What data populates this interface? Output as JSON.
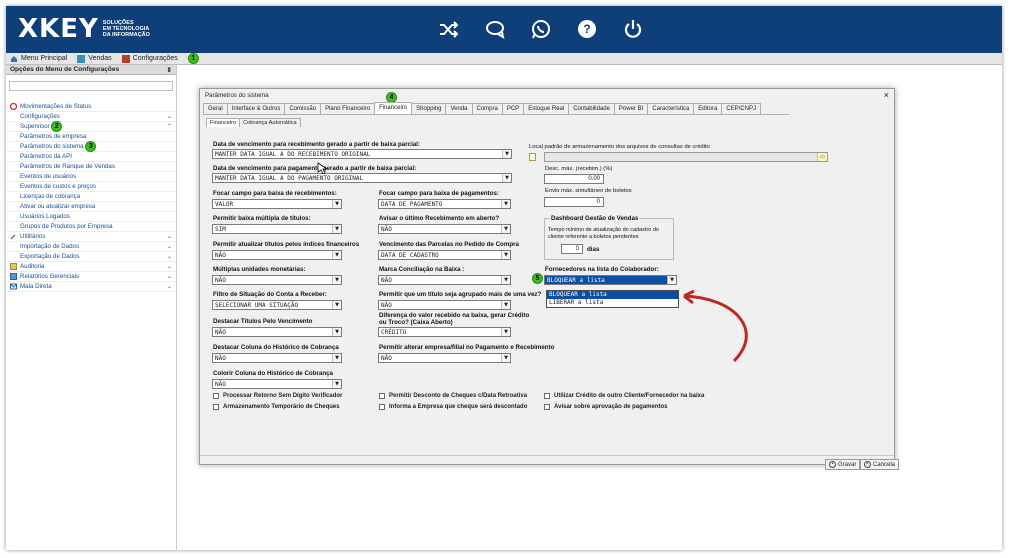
{
  "brand": {
    "name": "XKEY",
    "tagline_1": "SOLUÇÕES",
    "tagline_2": "EM TECNOLOGIA",
    "tagline_3": "DA INFORMAÇÃO"
  },
  "top_icons": [
    "shuffle-icon",
    "chat-icon",
    "whatsapp-icon",
    "help-icon",
    "power-icon"
  ],
  "menubar": {
    "items": [
      {
        "label": "Menu Principal",
        "icon": "home-icon"
      },
      {
        "label": "Vendas",
        "icon": "sales-icon"
      },
      {
        "label": "Configurações",
        "icon": "config-icon"
      }
    ],
    "badge": "1"
  },
  "sidebar": {
    "title": "Opções do Menu de Configurações",
    "items": [
      {
        "label": "Movimentações de Status",
        "type": "group"
      },
      {
        "label": "Configurações",
        "type": "group"
      },
      {
        "label": "Supervisor",
        "type": "group",
        "badge": "2"
      },
      {
        "label": "Parâmetros de empresa",
        "type": "sub"
      },
      {
        "label": "Parâmetros do sistema",
        "type": "sub",
        "badge": "3"
      },
      {
        "label": "Parâmetros da API",
        "type": "sub"
      },
      {
        "label": "Parâmetros de Ranque de Vendas",
        "type": "sub"
      },
      {
        "label": "Eventos de usuários",
        "type": "sub"
      },
      {
        "label": "Eventos de custos e preços",
        "type": "sub"
      },
      {
        "label": "Licenças de cobrança",
        "type": "sub"
      },
      {
        "label": "Ativar ou atualizar empresa",
        "type": "sub"
      },
      {
        "label": "Usuários Logados",
        "type": "sub"
      },
      {
        "label": "Grupos de Produtos por Empresa",
        "type": "sub"
      },
      {
        "label": "Utilitários",
        "type": "group"
      },
      {
        "label": "Importação de Dados",
        "type": "group"
      },
      {
        "label": "Exportação de Dados",
        "type": "group"
      },
      {
        "label": "Auditoria",
        "type": "group"
      },
      {
        "label": "Relatórios Gerenciais",
        "type": "group"
      },
      {
        "label": "Mala Direta",
        "type": "group"
      }
    ]
  },
  "dialog": {
    "title": "Parâmetros do sistema",
    "close": "×",
    "tabs": [
      "Geral",
      "Interface & Outros",
      "Comissão",
      "Plano Financeiro",
      "Financeiro",
      "Shopping",
      "Venda",
      "Compra",
      "PCP",
      "Estoque Real",
      "Contabilidade",
      "Power BI",
      "Característica",
      "Editora",
      "CEP/CNPJ"
    ],
    "tab_badge": "4",
    "subtabs": [
      "Financeiro",
      "Cobrança Automática"
    ],
    "fields": {
      "venc_receb_label": "Data de vencimento para recebimento gerado a partir de baixa parcial:",
      "venc_receb_value": "MANTER DATA IGUAL A DO RECEBIMENTO ORIGINAL",
      "venc_pag_label": "Data de vencimento para pagamento gerado a partir de baixa parcial:",
      "venc_pag_value": "MANTER DATA IGUAL A DO PAGAMENTO ORIGINAL",
      "focar_receb_label": "Focar campo para baixa de recebimentos:",
      "focar_receb_value": "VALOR",
      "focar_pag_label": "Focar campo para baixa de pagamentos:",
      "focar_pag_value": "DATA DE PAGAMENTO",
      "baixa_mult_label": "Permitir baixa múltipla de títulos:",
      "baixa_mult_value": "SIM",
      "avisar_label": "Avisar o último Recebimento em aberto?",
      "avisar_value": "NÃO",
      "atualizar_label": "Permitir atualizar títulos pelos índices financeiros",
      "atualizar_value": "NÃO",
      "venc_parc_label": "Vencimento das Parcelas no Pedido de Compra",
      "venc_parc_value": "DATA DE CADASTRO",
      "mult_unid_label": "Múltiplas unidades monetárias:",
      "mult_unid_value": "NÃO",
      "marca_conc_label": "Marca Conciliação na Baixa :",
      "marca_conc_value": "NÃO",
      "filtro_label": "Filtro de Situação do Conta a Receber:",
      "filtro_value": "SELECIONAR UMA SITUAÇÃO",
      "agrupado_label": "Permitir que um título seja agrupado mais de uma vez?",
      "agrupado_value": "NÃO",
      "destacar_venc_label": "Destacar Títulos Pelo Vencimento",
      "destacar_venc_value": "NÃO",
      "diferenca_label_1": "Diferença do valor recebido na baixa, gerar Crédito",
      "diferenca_label_2": "ou Troco? (Caixa Aberto)",
      "diferenca_value": "CRÉDITO",
      "destacar_col_label": "Destacar Coluna do Histórico de Cobrança",
      "destacar_col_value": "NÃO",
      "alterar_emp_label": "Permitir alterar empresa/filial no Pagamento e Recebimento",
      "alterar_emp_value": "NÃO",
      "colorir_label": "Colorir Coluna do Histórico de Cobrança",
      "colorir_value": "NÃO",
      "local_label": "Local padrão de armazenamento dos arquivos de consultas de crédito",
      "desc_label": "Desc. máx. (recebim.) (%)",
      "desc_value": "0.00",
      "envio_label": "Envio máx. simultâneo de boletos",
      "envio_value": "0",
      "dash_title": "Dashboard Gestão de Vendas",
      "dash_text_1": "Tempo mínimo de atualização do cadastro do",
      "dash_text_2": "cliente referente a boletos pendentes",
      "dash_value": "0",
      "dash_unit": "dias",
      "fornec_label": "Fornecedores na lista do Colaborador:",
      "fornec_value": "BLOQUEAR a lista",
      "fornec_badge": "5",
      "fornec_options": [
        "BLOQUEAR a lista",
        "LIBERAR a lista"
      ]
    },
    "checks": [
      "Processar Retorno Sem Dígito Verificador",
      "Armazenamento Temporário de Cheques",
      "Permitir Desconto de Cheques c/Data Retroativa",
      "Informa a Empresa que cheque será descontado",
      "Utilizar Crédito de outro Cliente/Fornecedor na baixa",
      "Avisar sobre aprovação de pagamentos"
    ],
    "save": "Gravar",
    "cancel": "Cancela"
  },
  "colors": {
    "topbar": "#0e3f79",
    "badge": "#3cbe1f",
    "highlight": "#0a4ea8",
    "arrow": "#c0281e"
  }
}
